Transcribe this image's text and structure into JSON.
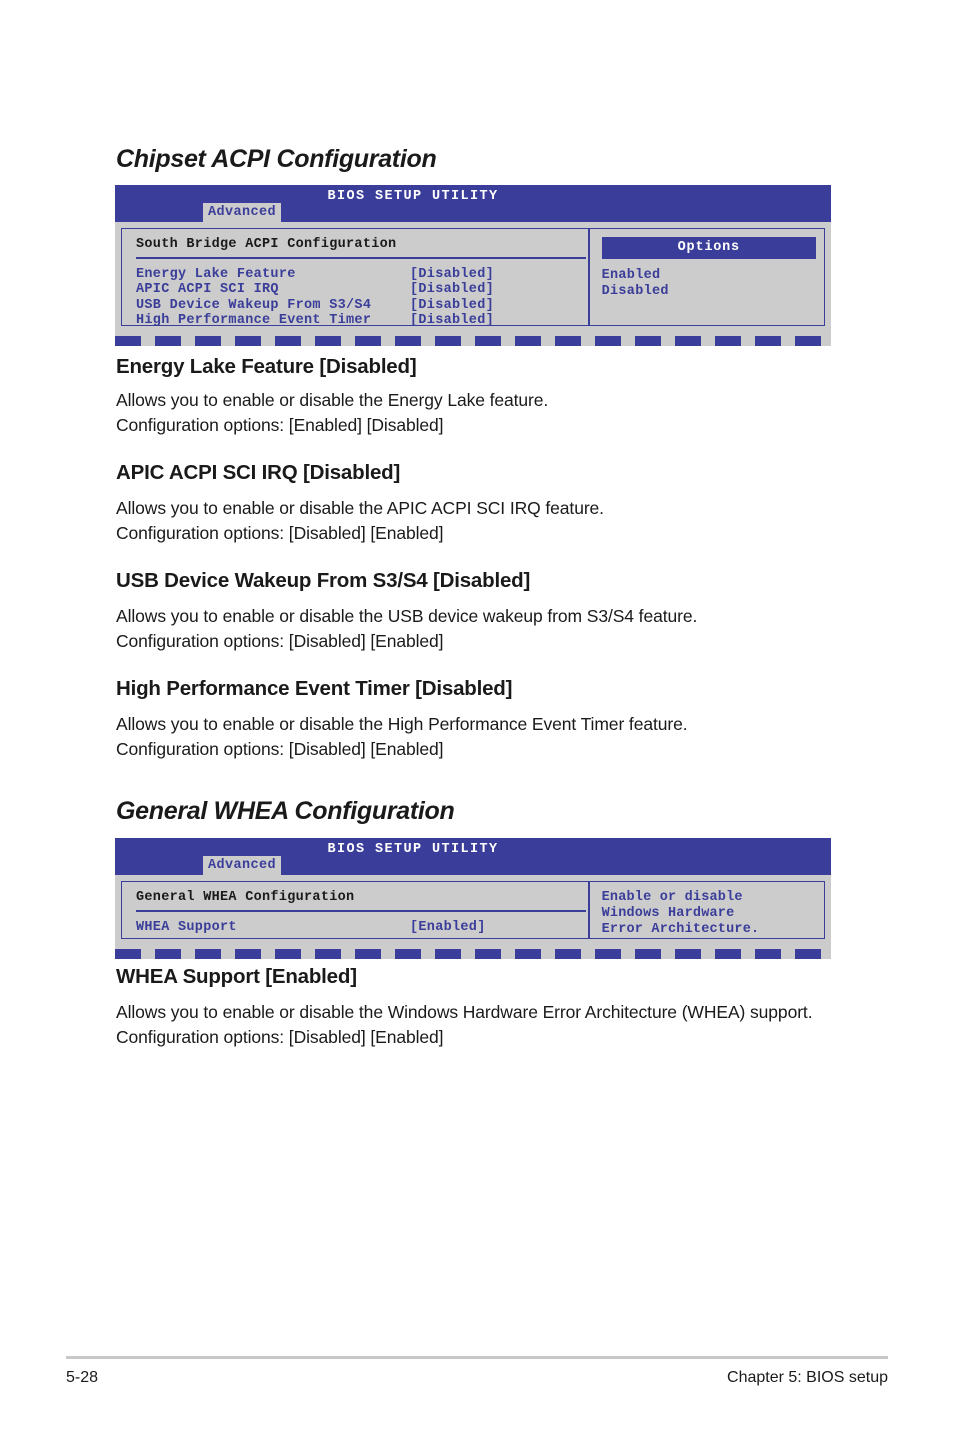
{
  "page": {
    "footer_page_number": "5-28",
    "footer_chapter": "Chapter 5: BIOS setup"
  },
  "colors": {
    "bios_blue": "#3a3d99",
    "bios_gray": "#cccccc",
    "text_black": "#1a1a1a"
  },
  "sections": [
    {
      "heading": "Chipset ACPI Configuration",
      "bios": {
        "title": "BIOS SETUP UTILITY",
        "tab": "Advanced",
        "panel_title": "South Bridge ACPI Configuration",
        "rows": [
          {
            "label": "Energy Lake Feature",
            "value": "[Disabled]"
          },
          {
            "label": "APIC ACPI SCI IRQ",
            "value": "[Disabled]"
          },
          {
            "label": "USB Device Wakeup From S3/S4",
            "value": "[Disabled]"
          },
          {
            "label": "High Performance Event Timer",
            "value": "[Disabled]"
          }
        ],
        "options_header": "Options",
        "options": [
          "Enabled",
          "Disabled"
        ]
      },
      "items": [
        {
          "title": "Energy Lake Feature [Disabled]",
          "desc": "Allows you to enable or disable the Energy Lake feature.",
          "config": "Configuration options: [Enabled] [Disabled]"
        },
        {
          "title": "APIC ACPI SCI IRQ [Disabled]",
          "desc": "Allows you to enable or disable the APIC ACPI SCI IRQ feature.",
          "config": "Configuration options: [Disabled] [Enabled]"
        },
        {
          "title": "USB Device Wakeup From S3/S4 [Disabled]",
          "desc": "Allows you to enable or disable the USB device wakeup from S3/S4 feature.",
          "config": "Configuration options: [Disabled] [Enabled]"
        },
        {
          "title": "High Performance Event Timer [Disabled]",
          "desc": "Allows you to enable or disable the High Performance Event Timer feature.",
          "config": "Configuration options: [Disabled] [Enabled]"
        }
      ]
    },
    {
      "heading": "General WHEA Configuration",
      "bios": {
        "title": "BIOS SETUP UTILITY",
        "tab": "Advanced",
        "panel_title": "General WHEA Configuration",
        "rows": [
          {
            "label": "WHEA Support",
            "value": "[Enabled]"
          }
        ],
        "help_line1": "Enable or disable",
        "help_line2": "Windows Hardware",
        "help_line3": "Error Architecture."
      },
      "items": [
        {
          "title": "WHEA Support [Enabled]",
          "desc": "Allows you to enable or disable the Windows Hardware Error Architecture (WHEA) support.",
          "config": "Configuration options: [Disabled] [Enabled]"
        }
      ]
    }
  ]
}
